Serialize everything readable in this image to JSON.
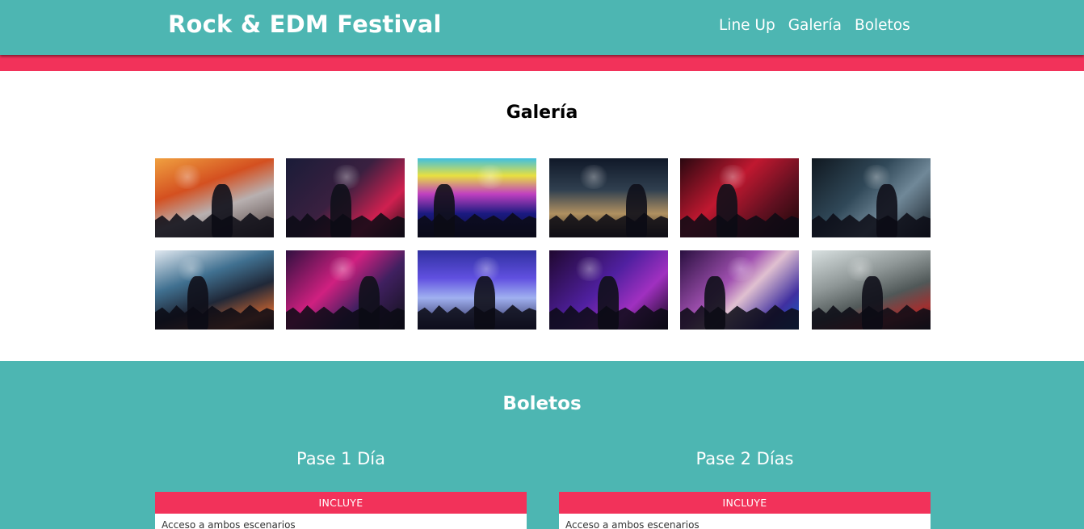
{
  "header": {
    "title": "Rock & EDM Festival",
    "nav": [
      "Line Up",
      "Galería",
      "Boletos"
    ]
  },
  "gallery": {
    "title": "Galería",
    "images": [
      {
        "name": "concert-crowd-smoke-photo",
        "bg": "linear-gradient(160deg,#f0a040 0%,#d45020 35%,#b8b0b0 60%,#4a3a38 100%)"
      },
      {
        "name": "rock-singer-red-stage-photo",
        "bg": "linear-gradient(135deg,#1a1c38 0%,#3a2040 45%,#d02050 75%,#201018 100%)"
      },
      {
        "name": "club-laser-crowd-photo",
        "bg": "linear-gradient(180deg,#40c0e0 0%,#e8e040 22%,#c040c0 45%,#1a1a80 70%,#0a0a30 100%)"
      },
      {
        "name": "dj-turntables-photo",
        "bg": "linear-gradient(180deg,#101828 0%,#304050 40%,#b09060 70%,#282018 100%)"
      },
      {
        "name": "guitarist-red-light-photo",
        "bg": "linear-gradient(135deg,#2a0810 0%,#c01830 40%,#601020 70%,#180808 100%)"
      },
      {
        "name": "female-dj-stage-photo",
        "bg": "linear-gradient(135deg,#101820 0%,#304858 40%,#708898 65%,#182028 100%)"
      },
      {
        "name": "electric-guitar-closeup-photo",
        "bg": "linear-gradient(160deg,#e0e8f0 0%,#407090 35%,#202838 60%,#c06030 85%,#402018 100%)"
      },
      {
        "name": "dj-laptop-pink-photo",
        "bg": "linear-gradient(135deg,#301040 0%,#d02080 40%,#402060 65%,#101018 100%)"
      },
      {
        "name": "dj-mixer-blue-photo",
        "bg": "linear-gradient(180deg,#3030a0 0%,#6050e0 35%,#a0b0f0 60%,#202050 100%)"
      },
      {
        "name": "mixer-purple-neon-photo",
        "bg": "linear-gradient(135deg,#200830 0%,#5020a0 45%,#a030c0 70%,#100818 100%)"
      },
      {
        "name": "two-musicians-stage-photo",
        "bg": "linear-gradient(135deg,#2a1040 0%,#a050b0 40%,#e0c0d0 55%,#4030a0 80%,#1060c0 100%)"
      },
      {
        "name": "performer-smoke-sparks-photo",
        "bg": "linear-gradient(160deg,#d8e0e0 0%,#909898 35%,#505858 60%,#a03030 80%,#202020 100%)"
      }
    ]
  },
  "tickets": {
    "title": "Boletos",
    "passes": [
      {
        "name": "Pase 1 Día",
        "includes_label": "INCLUYE",
        "features": [
          "Acceso a ambos escenarios"
        ]
      },
      {
        "name": "Pase 2 Días",
        "includes_label": "INCLUYE",
        "features": [
          "Acceso a ambos escenarios"
        ]
      }
    ]
  },
  "colors": {
    "teal": "#4db6b2",
    "accent_pink": "#f2325a",
    "white": "#ffffff"
  }
}
